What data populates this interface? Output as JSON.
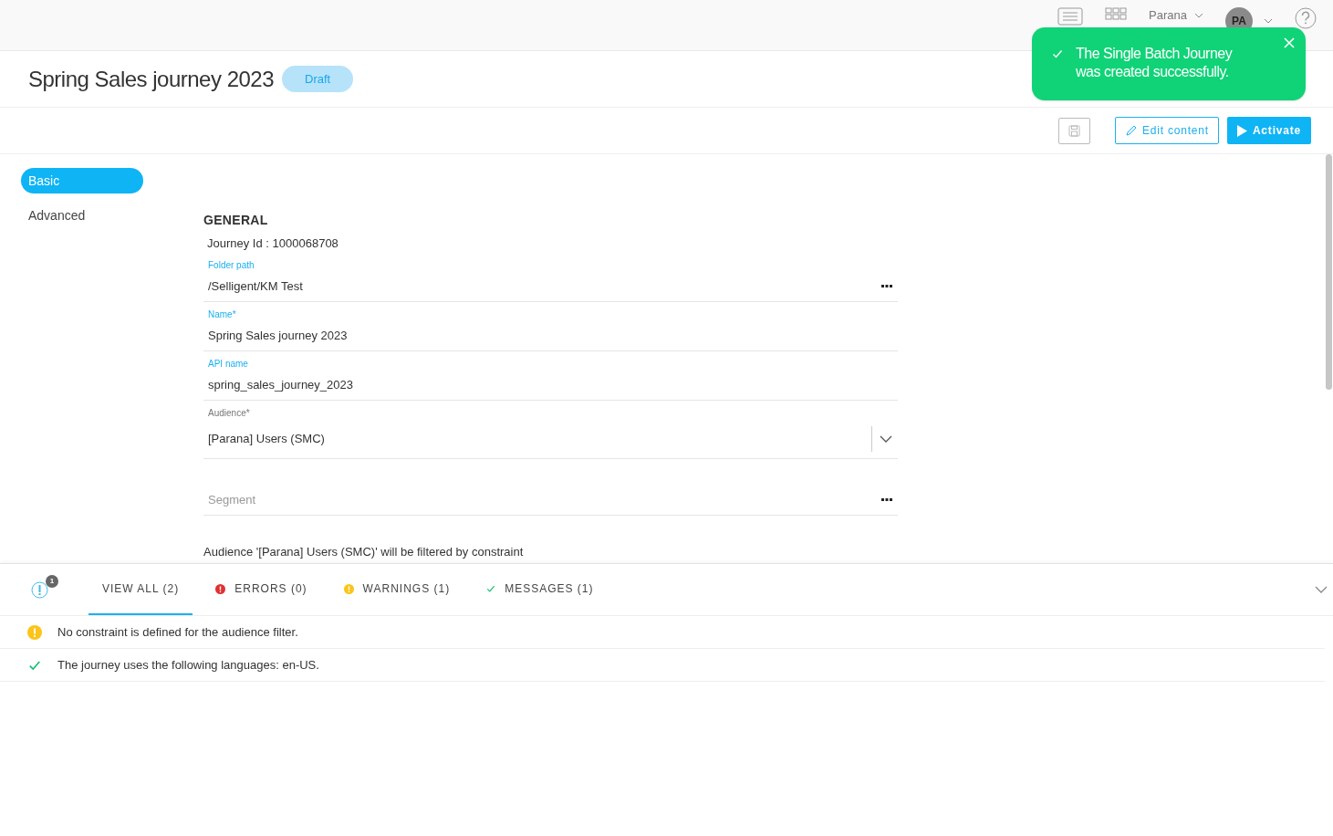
{
  "top_bar": {
    "org": "Parana",
    "avatar": "PA"
  },
  "toast": {
    "message": "The Single Batch Journey was created successfully."
  },
  "header": {
    "title": "Spring Sales journey 2023",
    "status": "Draft"
  },
  "toolbar": {
    "buttons": [
      {
        "kind": "save"
      },
      {
        "kind": "edit",
        "label": "Edit content"
      },
      {
        "kind": "activate",
        "label": "Activate"
      }
    ]
  },
  "side_nav": [
    {
      "label": "Basic",
      "selected": true
    },
    {
      "label": "Advanced",
      "selected": false
    }
  ],
  "form": {
    "section": "GENERAL",
    "journey_id": "Journey Id : 1000068708",
    "fields": [
      {
        "kind": "picker",
        "label": "Folder path",
        "value": "/Selligent/KM Test"
      },
      {
        "kind": "text",
        "label": "Name*",
        "value": "Spring Sales journey 2023"
      },
      {
        "kind": "text",
        "label": "API name",
        "value": "spring_sales_journey_2023"
      },
      {
        "kind": "select",
        "label": "Audience*",
        "value": "[Parana] Users (SMC)"
      },
      {
        "kind": "picker",
        "placeholder": "Segment"
      }
    ],
    "note": "Audience '[Parana] Users (SMC)' will be filtered by constraint"
  },
  "messages_panel": {
    "badge": "1",
    "tabs": [
      {
        "kind": "all",
        "label": "VIEW ALL (2)",
        "selected": true
      },
      {
        "kind": "error",
        "label": "ERRORS (0)",
        "selected": false
      },
      {
        "kind": "warning",
        "label": "WARNINGS (1)",
        "selected": false
      },
      {
        "kind": "message",
        "label": "MESSAGES (1)",
        "selected": false
      }
    ],
    "items": [
      {
        "kind": "warning",
        "text": "No constraint is defined for the audience filter."
      },
      {
        "kind": "message",
        "text": "The journey uses the following languages: en-US."
      }
    ]
  }
}
